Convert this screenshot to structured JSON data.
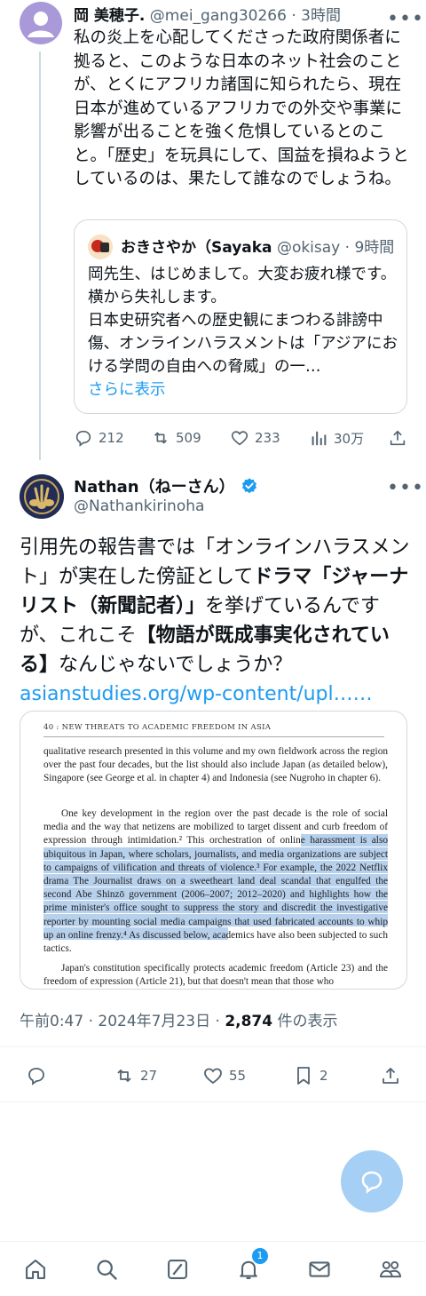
{
  "parent_tweet": {
    "display_name": "岡 美穂子.",
    "handle": "@mei_gang30266",
    "time": "3時間",
    "body": "私の炎上を心配してくださった政府関係者に拠ると、このような日本のネット社会のことが、とくにアフリカ諸国に知られたら、現在日本が進めているアフリカでの外交や事業に影響が出ることを強く危惧しているとのこと。「歴史」を玩具にして、国益を損ねようとしているのは、果たして誰なのでしょうね。",
    "quote": {
      "display_name": "おきさやか（Sayaka",
      "handle": "@okisay",
      "time": "9時間",
      "body": "岡先生、はじめまして。大変お疲れ様です。横から失礼します。\n日本史研究者への歴史観にまつわる誹謗中傷、オンラインハラスメントは「アジアにおける学問の自由への脅威」の一…",
      "show_more": "さらに表示"
    },
    "actions": {
      "replies": "212",
      "retweets": "509",
      "likes": "233",
      "views": "30万"
    }
  },
  "main_tweet": {
    "display_name": "Nathan（ねーさん）",
    "handle": "@Nathankirinoha",
    "body_parts": {
      "p1": "引用先の報告書では「オンラインハラスメント」が実在した傍証として",
      "p2": "ドラマ「ジャーナリスト（新聞記者）」",
      "p3": "を挙げているんですが、これこそ",
      "p4": "【物語が既成事実化されている】",
      "p5": "なんじゃないでしょうか？",
      "link": "asianstudies.org/wp-content/upl……"
    },
    "document": {
      "header": "40 : NEW THREATS TO ACADEMIC FREEDOM IN ASIA",
      "para1": "qualitative research presented in this volume and my own fieldwork across the region over the past four decades, but the list should also include Japan (as detailed below), Singapore (see George et al. in chapter 4) and Indonesia (see Nugroho in chapter 6).",
      "para2": "One key development in the region over the past decade is the role of social media and the way that netizens are mobilized to target dissent and curb freedom of expression through intimidation.² This orchestration of online harassment is also ubiquitous in Japan, where scholars, journalists, and media organizations are subject to campaigns of vilification and threats of violence.³ For example, the 2022 Netflix drama The Journalist draws on a sweetheart land deal scandal that engulfed the second Abe Shinzō government (2006–2007; 2012–2020) and highlights how the prime minister's office sought to suppress the story and discredit the investigative reporter by mounting social media campaigns that used fabricated accounts to whip up an online frenzy.⁴ As discussed below, academics have also been subjected to such tactics.",
      "para3": "Japan's constitution specifically protects academic freedom (Article 23) and the freedom of expression (Article 21), but that doesn't mean that those who"
    },
    "meta": {
      "datetime": "午前0:47 · 2024年7月23日 · ",
      "views_count": "2,874",
      "views_label": " 件の表示"
    },
    "actions": {
      "retweets": "27",
      "likes": "55",
      "bookmarks": "2"
    }
  },
  "navbar": {
    "notification_count": "1"
  },
  "colors": {
    "accent": "#1d9bf0",
    "highlight": "#b7d0ec",
    "secondary_text": "#536471"
  }
}
